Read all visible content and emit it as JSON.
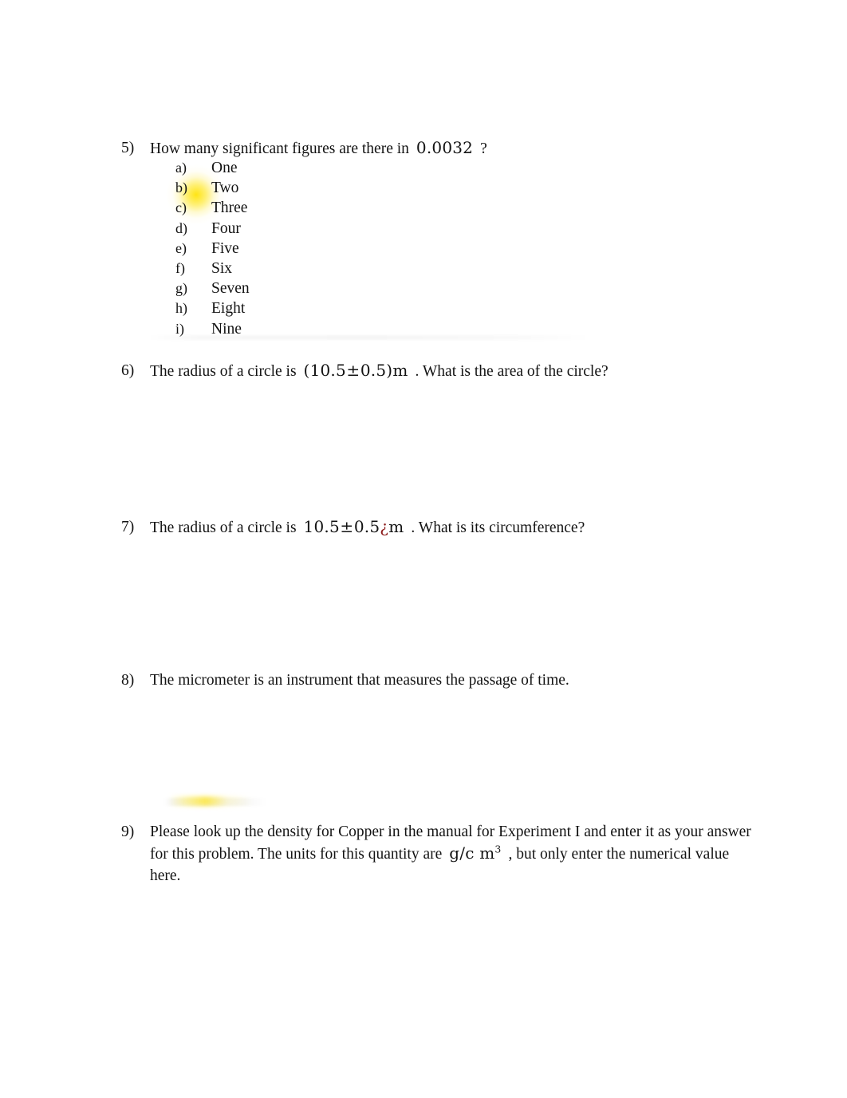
{
  "document": {
    "questions": [
      {
        "number": "5)",
        "text_before": "How many significant figures are there in",
        "math": "0.0032",
        "text_after": "?",
        "options": [
          {
            "letter": "a)",
            "text": "One"
          },
          {
            "letter": "b)",
            "text": "Two"
          },
          {
            "letter": "c)",
            "text": "Three"
          },
          {
            "letter": "d)",
            "text": "Four"
          },
          {
            "letter": "e)",
            "text": "Five"
          },
          {
            "letter": "f)",
            "text": "Six"
          },
          {
            "letter": "g)",
            "text": "Seven"
          },
          {
            "letter": "h)",
            "text": "Eight"
          },
          {
            "letter": "i)",
            "text": "Nine"
          }
        ]
      },
      {
        "number": "6)",
        "text_before": "The radius of a circle is",
        "math_open": "(",
        "math_value": "10.5",
        "math_pm": "±",
        "math_error": "0.5",
        "math_close": ")",
        "math_unit": "m",
        "text_after": ". What is the area of the circle?"
      },
      {
        "number": "7)",
        "text_before": "The radius of a circle is",
        "math_value": "10.5",
        "math_pm": "±",
        "math_error": "0.5",
        "math_artifact": "¿",
        "math_unit": "m",
        "text_after": ". What is its circumference?"
      },
      {
        "number": "8)",
        "text": "The micrometer is an instrument that measures the passage of time."
      },
      {
        "number": "9)",
        "text_part1": "Please look up the density for Copper in the manual for Experiment I and enter it as your answer for this problem. The units for this quantity are",
        "math_unit_base": "g/c m",
        "math_unit_exponent": "3",
        "text_part2": ", but only enter the numerical value here."
      }
    ]
  },
  "colors": {
    "text": "#131313",
    "artifact_red": "#8c1b1b",
    "highlighter_yellow": "#ffe200",
    "page_background": "#ffffff"
  }
}
